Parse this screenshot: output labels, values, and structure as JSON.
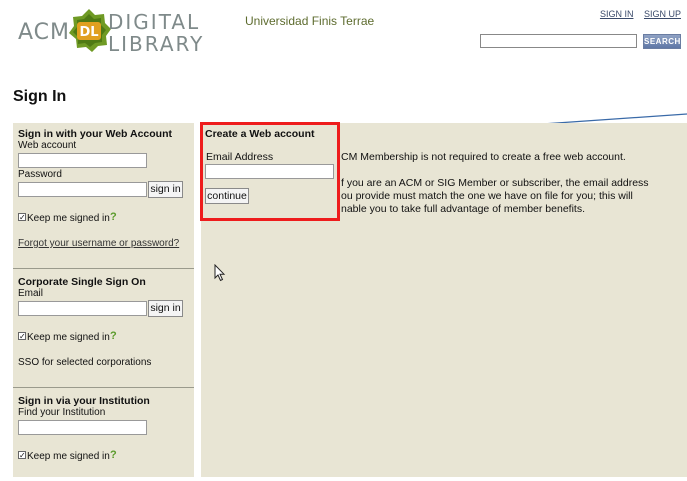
{
  "header": {
    "logo": {
      "acm": "ACM",
      "badge": "DL",
      "digital": "DIGITAL",
      "library": "LIBRARY"
    },
    "institution": "Universidad Finis Terrae",
    "sign_in_link": "SIGN IN",
    "sign_up_link": "SIGN UP",
    "search": {
      "value": "",
      "button": "SEARCH"
    }
  },
  "page_title": "Sign In",
  "web_account": {
    "title": "Sign in with your Web Account",
    "web_account_label": "Web account",
    "password_label": "Password",
    "sign_in_button": "sign in",
    "keep_signed_in": "Keep me signed in",
    "forgot_link": "Forgot your username or password?"
  },
  "corporate_sso": {
    "title": "Corporate Single Sign On",
    "email_label": "Email",
    "sign_in_button": "sign in",
    "keep_signed_in": "Keep me signed in",
    "note": "SSO for selected corporations"
  },
  "institution_signin": {
    "title": "Sign in via your Institution",
    "find_label": "Find your Institution",
    "keep_signed_in": "Keep me signed in"
  },
  "create_account": {
    "title": "Create a Web account",
    "email_label": "Email Address",
    "continue_button": "continue",
    "info_line1": "CM Membership is not required to create a free web account.",
    "info_line2": "f you are an ACM or SIG Member or subscriber, the email address",
    "info_line3": "ou provide must match the one we have on file for you; this will",
    "info_line4": "nable you to take full advantage of member benefits."
  },
  "colors": {
    "panel_bg": "#e8e5d4",
    "highlight_border": "#ee1c1c",
    "logo_green": "#5a8a1a",
    "help_green": "#5a9a2a",
    "annotation_line": "#3a6aa8"
  },
  "icons": {
    "help": "question-mark-icon",
    "pointer": "mouse-cursor-icon",
    "checkbox": "checkbox-checked-icon"
  }
}
